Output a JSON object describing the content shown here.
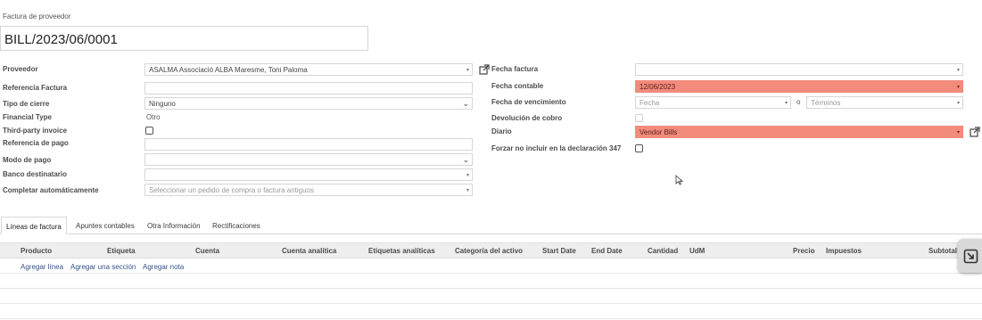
{
  "header": {
    "label": "Factura de proveedor",
    "bill_number": "BILL/2023/06/0001"
  },
  "left_fields": {
    "proveedor": {
      "label": "Proveedor",
      "value": "ASALMA Associació ALBA Maresme, Toni Paloma"
    },
    "referencia_factura": {
      "label": "Referencia Factura",
      "value": ""
    },
    "tipo_cierre": {
      "label": "Tipo de cierre",
      "value": "Ninguno"
    },
    "financial_type": {
      "label": "Financial Type",
      "value": "Otro"
    },
    "third_party": {
      "label": "Third-party invoice",
      "checked": false
    },
    "referencia_pago": {
      "label": "Referencia de pago",
      "value": ""
    },
    "modo_pago": {
      "label": "Modo de pago",
      "value": ""
    },
    "banco": {
      "label": "Banco destinatario",
      "value": ""
    },
    "completar": {
      "label": "Completar automáticamente",
      "placeholder": "Seleccionar un pedido de compra o factura antiguos"
    }
  },
  "right_fields": {
    "fecha_factura": {
      "label": "Fecha factura",
      "value": ""
    },
    "fecha_contable": {
      "label": "Fecha contable",
      "value": "12/06/2023"
    },
    "fecha_vencimiento": {
      "label": "Fecha de vencimiento",
      "date_placeholder": "Fecha",
      "separator": "o",
      "terms_placeholder": "Términos"
    },
    "devolucion": {
      "label": "Devolución de cobro",
      "checked": false
    },
    "diario": {
      "label": "Diario",
      "value": "Vendor Bills"
    },
    "forzar": {
      "label": "Forzar no incluir en la declaración 347",
      "checked": false
    }
  },
  "tabs": [
    {
      "label": "Líneas de factura",
      "active": true
    },
    {
      "label": "Apuntes contables",
      "active": false
    },
    {
      "label": "Otra Información",
      "active": false
    },
    {
      "label": "Rectificaciones",
      "active": false
    }
  ],
  "table": {
    "columns": [
      "Producto",
      "Etiqueta",
      "Cuenta",
      "Cuenta analítica",
      "Etiquetas analíticas",
      "Categoría del activo",
      "Start Date",
      "End Date",
      "Cantidad",
      "UdM",
      "Precio",
      "Impuestos",
      "Subtotal"
    ],
    "actions": [
      "Agregar línea",
      "Agregar una sección",
      "Agregar nota"
    ]
  },
  "icons": {
    "external_link": "external-link-icon",
    "dropdown": "caret-down-icon",
    "cursor": "mouse-cursor-icon",
    "floating": "collapse-window-icon"
  }
}
